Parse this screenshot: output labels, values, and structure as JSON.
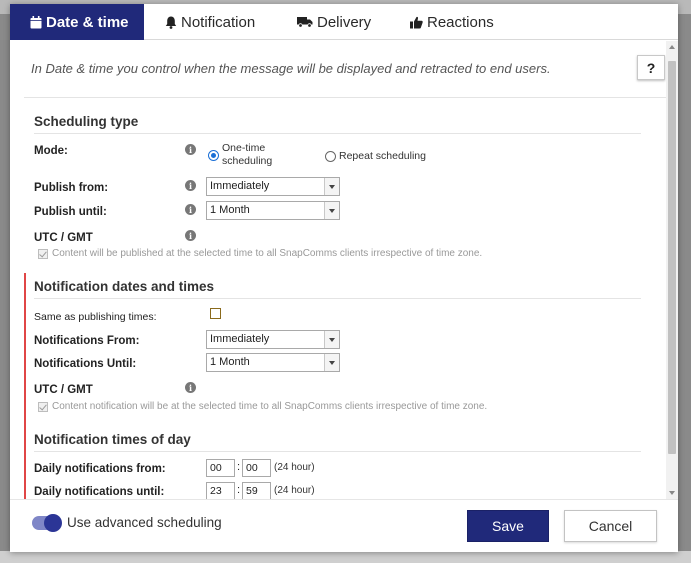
{
  "tabs": [
    {
      "label": "Date & time",
      "icon": "calendar-icon",
      "active": true
    },
    {
      "label": "Notification",
      "icon": "bell-icon",
      "active": false
    },
    {
      "label": "Delivery",
      "icon": "truck-icon",
      "active": false
    },
    {
      "label": "Reactions",
      "icon": "thumbs-up-icon",
      "active": false
    }
  ],
  "intro": "In Date & time you control when the message will be displayed and retracted to end users.",
  "help_label": "?",
  "scheduling": {
    "title": "Scheduling type",
    "mode_label": "Mode:",
    "mode_options": [
      "One-time scheduling",
      "Repeat scheduling"
    ],
    "mode_option_one_line1": "One-time",
    "mode_option_one_line2": "scheduling",
    "mode_selected": "One-time scheduling",
    "publish_from_label": "Publish from:",
    "publish_from_value": "Immediately",
    "publish_until_label": "Publish until:",
    "publish_until_value": "1 Month",
    "utc_label": "UTC / GMT",
    "utc_note": "Content will be published at the selected time to all SnapComms clients irrespective of time zone."
  },
  "notification_dates": {
    "title": "Notification dates and times",
    "same_as_label": "Same as publishing times:",
    "from_label": "Notifications From:",
    "from_value": "Immediately",
    "until_label": "Notifications Until:",
    "until_value": "1 Month",
    "utc_label": "UTC / GMT",
    "utc_note": "Content notification will be at the selected time to all SnapComms clients irrespective of time zone."
  },
  "times_of_day": {
    "title": "Notification times of day",
    "daily_from_label": "Daily notifications from:",
    "daily_from_hour": "00",
    "daily_from_minute": "00",
    "daily_until_label": "Daily notifications until:",
    "daily_until_hour": "23",
    "daily_until_minute": "59",
    "hour_note": "(24 hour)",
    "colon": ":"
  },
  "footer": {
    "advanced_label": "Use advanced scheduling",
    "advanced_on": true,
    "save_label": "Save",
    "cancel_label": "Cancel"
  },
  "colors": {
    "accent": "#20297a",
    "section_marker": "#e04646",
    "radio_selected": "#1a6fd6"
  }
}
